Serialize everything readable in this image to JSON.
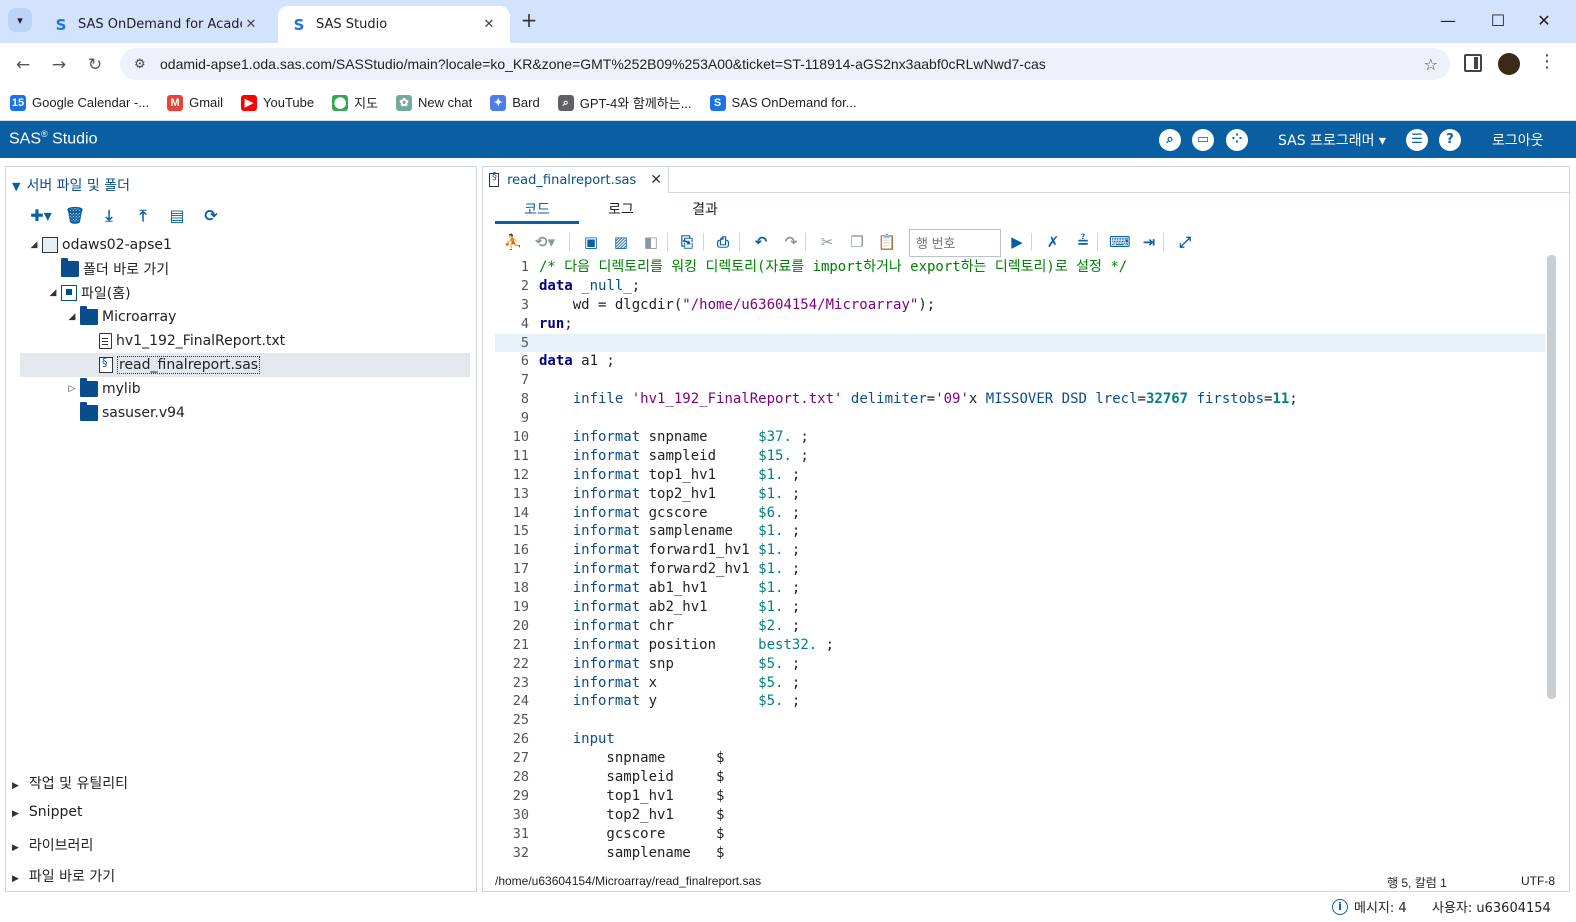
{
  "browser": {
    "tabs": [
      {
        "title": "SAS OnDemand for Academics",
        "favicon": "sas-s-icon"
      },
      {
        "title": "SAS Studio",
        "favicon": "sas-s-icon",
        "active": true
      }
    ],
    "url": "odamid-apse1.oda.sas.com/SASStudio/main?locale=ko_KR&zone=GMT%252B09%253A00&ticket=ST-118914-aGS2nx3aabf0cRLwNwd7-cas",
    "bookmarks": [
      {
        "label": "Google Calendar -...",
        "icon": "calendar-icon",
        "color": "#1a73e8"
      },
      {
        "label": "Gmail",
        "icon": "gmail-icon",
        "color": "#ea4335"
      },
      {
        "label": "YouTube",
        "icon": "youtube-icon",
        "color": "#ff0000"
      },
      {
        "label": "지도",
        "icon": "maps-pin-icon",
        "color": "#34a853"
      },
      {
        "label": "New chat",
        "icon": "chatgpt-icon",
        "color": "#74aa9c"
      },
      {
        "label": "Bard",
        "icon": "bard-sparkle-icon",
        "color": "#4e7de9"
      },
      {
        "label": "GPT-4와 함께하는...",
        "icon": "search-icon",
        "color": "#5f6368"
      },
      {
        "label": "SAS OnDemand for...",
        "icon": "sas-s-icon",
        "color": "#1a73e8"
      }
    ]
  },
  "sas": {
    "brand": "SAS",
    "brand_sup": "®",
    "brand_rest": " Studio",
    "program_menu": "SAS 프로그래머 ▾",
    "logout": "로그아웃"
  },
  "left": {
    "header": "서버 파일 및 폴더",
    "tree": [
      {
        "label": "odaws02-apse1",
        "icon": "server-icon",
        "depth": 0,
        "toggle": "▼"
      },
      {
        "label": "폴더 바로 가기",
        "icon": "folder-shortcut-icon",
        "depth": 1,
        "toggle": ""
      },
      {
        "label": "파일(홈)",
        "icon": "home-folder-icon",
        "depth": 1,
        "toggle": "▼"
      },
      {
        "label": "Microarray",
        "icon": "folder-icon",
        "depth": 2,
        "toggle": "▼"
      },
      {
        "label": "hv1_192_FinalReport.txt",
        "icon": "text-file-icon",
        "depth": 3,
        "toggle": ""
      },
      {
        "label": "read_finalreport.sas",
        "icon": "sas-program-icon",
        "depth": 3,
        "toggle": "",
        "selected": true
      },
      {
        "label": "mylib",
        "icon": "folder-icon",
        "depth": 2,
        "toggle": "▶"
      },
      {
        "label": "sasuser.v94",
        "icon": "folder-icon",
        "depth": 2,
        "toggle": ""
      }
    ],
    "sections": [
      "작업 및 유틸리티",
      "Snippet",
      "라이브러리",
      "파일 바로 가기"
    ]
  },
  "editor": {
    "file_tab": "read_finalreport.sas",
    "subtabs": [
      "코드",
      "로그",
      "결과"
    ],
    "line_placeholder": "행 번호",
    "status_path": "/home/u63604154/Microarray/read_finalreport.sas",
    "status_pos": "행 5, 칼럼 1",
    "status_enc": "UTF-8",
    "current_line": 5,
    "code": [
      "/* 다음 디렉토리를 워킹 디렉토리(자료를 import하거나 export하는 디렉토리)로 설정 */",
      "data _null_;",
      "    wd = dlgcdir(\"/home/u63604154/Microarray\");",
      "run;",
      "",
      "data a1 ;",
      "",
      "    infile 'hv1_192_FinalReport.txt' delimiter='09'x MISSOVER DSD lrecl=32767 firstobs=11;",
      "",
      "    informat snpname      $37. ;",
      "    informat sampleid     $15. ;",
      "    informat top1_hv1     $1. ;",
      "    informat top2_hv1     $1. ;",
      "    informat gcscore      $6. ;",
      "    informat samplename   $1. ;",
      "    informat forward1_hv1 $1. ;",
      "    informat forward2_hv1 $1. ;",
      "    informat ab1_hv1      $1. ;",
      "    informat ab2_hv1      $1. ;",
      "    informat chr          $2. ;",
      "    informat position     best32. ;",
      "    informat snp          $5. ;",
      "    informat x            $5. ;",
      "    informat y            $5. ;",
      "",
      "    input",
      "        snpname      $",
      "        sampleid     $",
      "        top1_hv1     $",
      "        top2_hv1     $",
      "        gcscore      $",
      "        samplename   $"
    ]
  },
  "footer": {
    "messages": "메시지: 4",
    "user": "사용자: u63604154"
  }
}
